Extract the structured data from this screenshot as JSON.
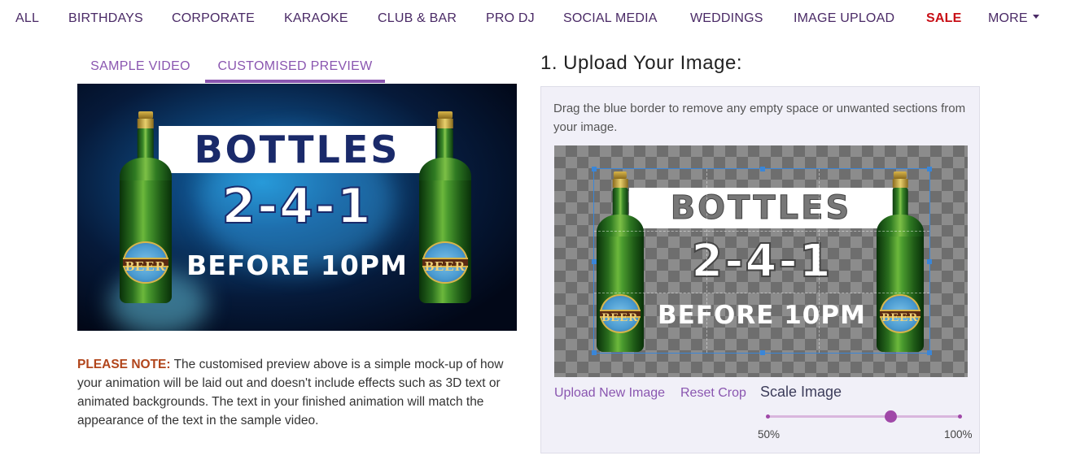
{
  "nav": {
    "items": [
      "ALL",
      "BIRTHDAYS",
      "CORPORATE",
      "KARAOKE",
      "CLUB & BAR",
      "PRO DJ",
      "SOCIAL MEDIA",
      "WEDDINGS",
      "IMAGE UPLOAD",
      "SALE",
      "MORE"
    ],
    "sale_color": "#c80f16",
    "link_color": "#4a2a66"
  },
  "preview_tabs": {
    "sample": "SAMPLE VIDEO",
    "custom": "CUSTOMISED PREVIEW",
    "active": "custom"
  },
  "preview_image": {
    "title": "BOTTLES",
    "offer": "2-4-1",
    "subtitle": "BEFORE 10PM",
    "bottle_label": "BEER"
  },
  "note": {
    "label": "PLEASE NOTE:",
    "text": " The customised preview above is a simple mock-up of how your animation will be laid out and doesn't include effects such as 3D text or animated backgrounds. The text in your finished animation will match the appearance of the text in the sample video."
  },
  "upload": {
    "title": "1. Upload Your Image:",
    "help": "Drag the blue border to remove any empty space or unwanted sections from your image.",
    "upload_new": "Upload New Image",
    "reset_crop": "Reset Crop",
    "scale_label": "Scale Image",
    "scale_min": "50%",
    "scale_max": "100%",
    "scale_value_percent": 86
  },
  "colors": {
    "accent": "#8a56b0",
    "slider": "#a048a8",
    "note_label": "#b1451b",
    "crop_border": "#3a86d8"
  }
}
